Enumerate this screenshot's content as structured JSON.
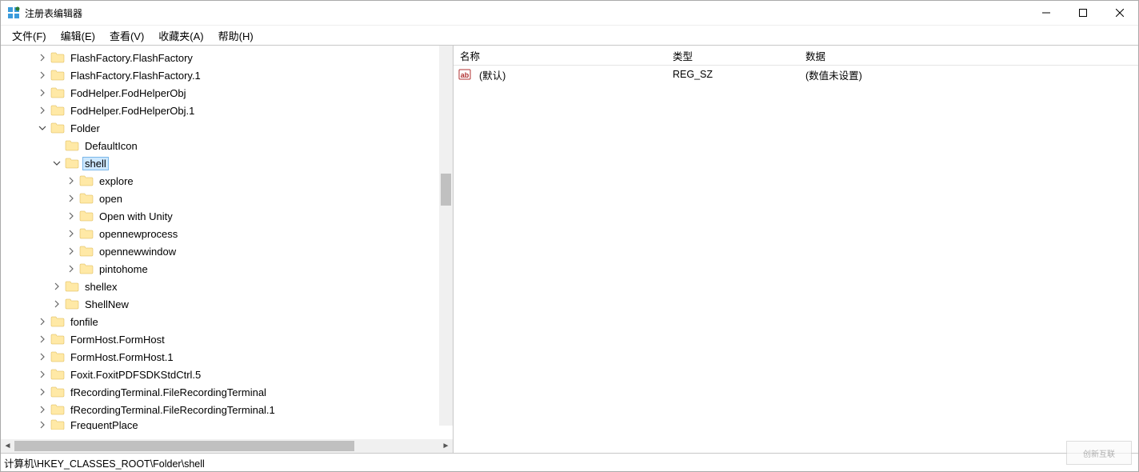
{
  "window": {
    "title": "注册表编辑器"
  },
  "menu": {
    "file": "文件(F)",
    "edit": "编辑(E)",
    "view": "查看(V)",
    "favorites": "收藏夹(A)",
    "help": "帮助(H)"
  },
  "watermark": "创新互联",
  "tree": {
    "items": [
      {
        "indent": 2,
        "exp": ">",
        "label": "FlashFactory.FlashFactory"
      },
      {
        "indent": 2,
        "exp": ">",
        "label": "FlashFactory.FlashFactory.1"
      },
      {
        "indent": 2,
        "exp": ">",
        "label": "FodHelper.FodHelperObj"
      },
      {
        "indent": 2,
        "exp": ">",
        "label": "FodHelper.FodHelperObj.1"
      },
      {
        "indent": 2,
        "exp": "v",
        "label": "Folder"
      },
      {
        "indent": 3,
        "exp": "",
        "label": "DefaultIcon"
      },
      {
        "indent": 3,
        "exp": "v",
        "label": "shell",
        "selected": true
      },
      {
        "indent": 4,
        "exp": ">",
        "label": "explore"
      },
      {
        "indent": 4,
        "exp": ">",
        "label": "open"
      },
      {
        "indent": 4,
        "exp": ">",
        "label": "Open with Unity"
      },
      {
        "indent": 4,
        "exp": ">",
        "label": "opennewprocess"
      },
      {
        "indent": 4,
        "exp": ">",
        "label": "opennewwindow"
      },
      {
        "indent": 4,
        "exp": ">",
        "label": "pintohome"
      },
      {
        "indent": 3,
        "exp": ">",
        "label": "shellex"
      },
      {
        "indent": 3,
        "exp": ">",
        "label": "ShellNew"
      },
      {
        "indent": 2,
        "exp": ">",
        "label": "fonfile"
      },
      {
        "indent": 2,
        "exp": ">",
        "label": "FormHost.FormHost"
      },
      {
        "indent": 2,
        "exp": ">",
        "label": "FormHost.FormHost.1"
      },
      {
        "indent": 2,
        "exp": ">",
        "label": "Foxit.FoxitPDFSDKStdCtrl.5"
      },
      {
        "indent": 2,
        "exp": ">",
        "label": "fRecordingTerminal.FileRecordingTerminal"
      },
      {
        "indent": 2,
        "exp": ">",
        "label": "fRecordingTerminal.FileRecordingTerminal.1"
      },
      {
        "indent": 2,
        "exp": ">",
        "label": "FrequentPlace",
        "truncated": true
      }
    ]
  },
  "list": {
    "headers": {
      "name": "名称",
      "type": "类型",
      "data": "数据"
    },
    "rows": [
      {
        "icon": "string-value-icon",
        "name": "(默认)",
        "type": "REG_SZ",
        "data": "(数值未设置)"
      }
    ]
  },
  "statusbar": {
    "path": "计算机\\HKEY_CLASSES_ROOT\\Folder\\shell"
  }
}
